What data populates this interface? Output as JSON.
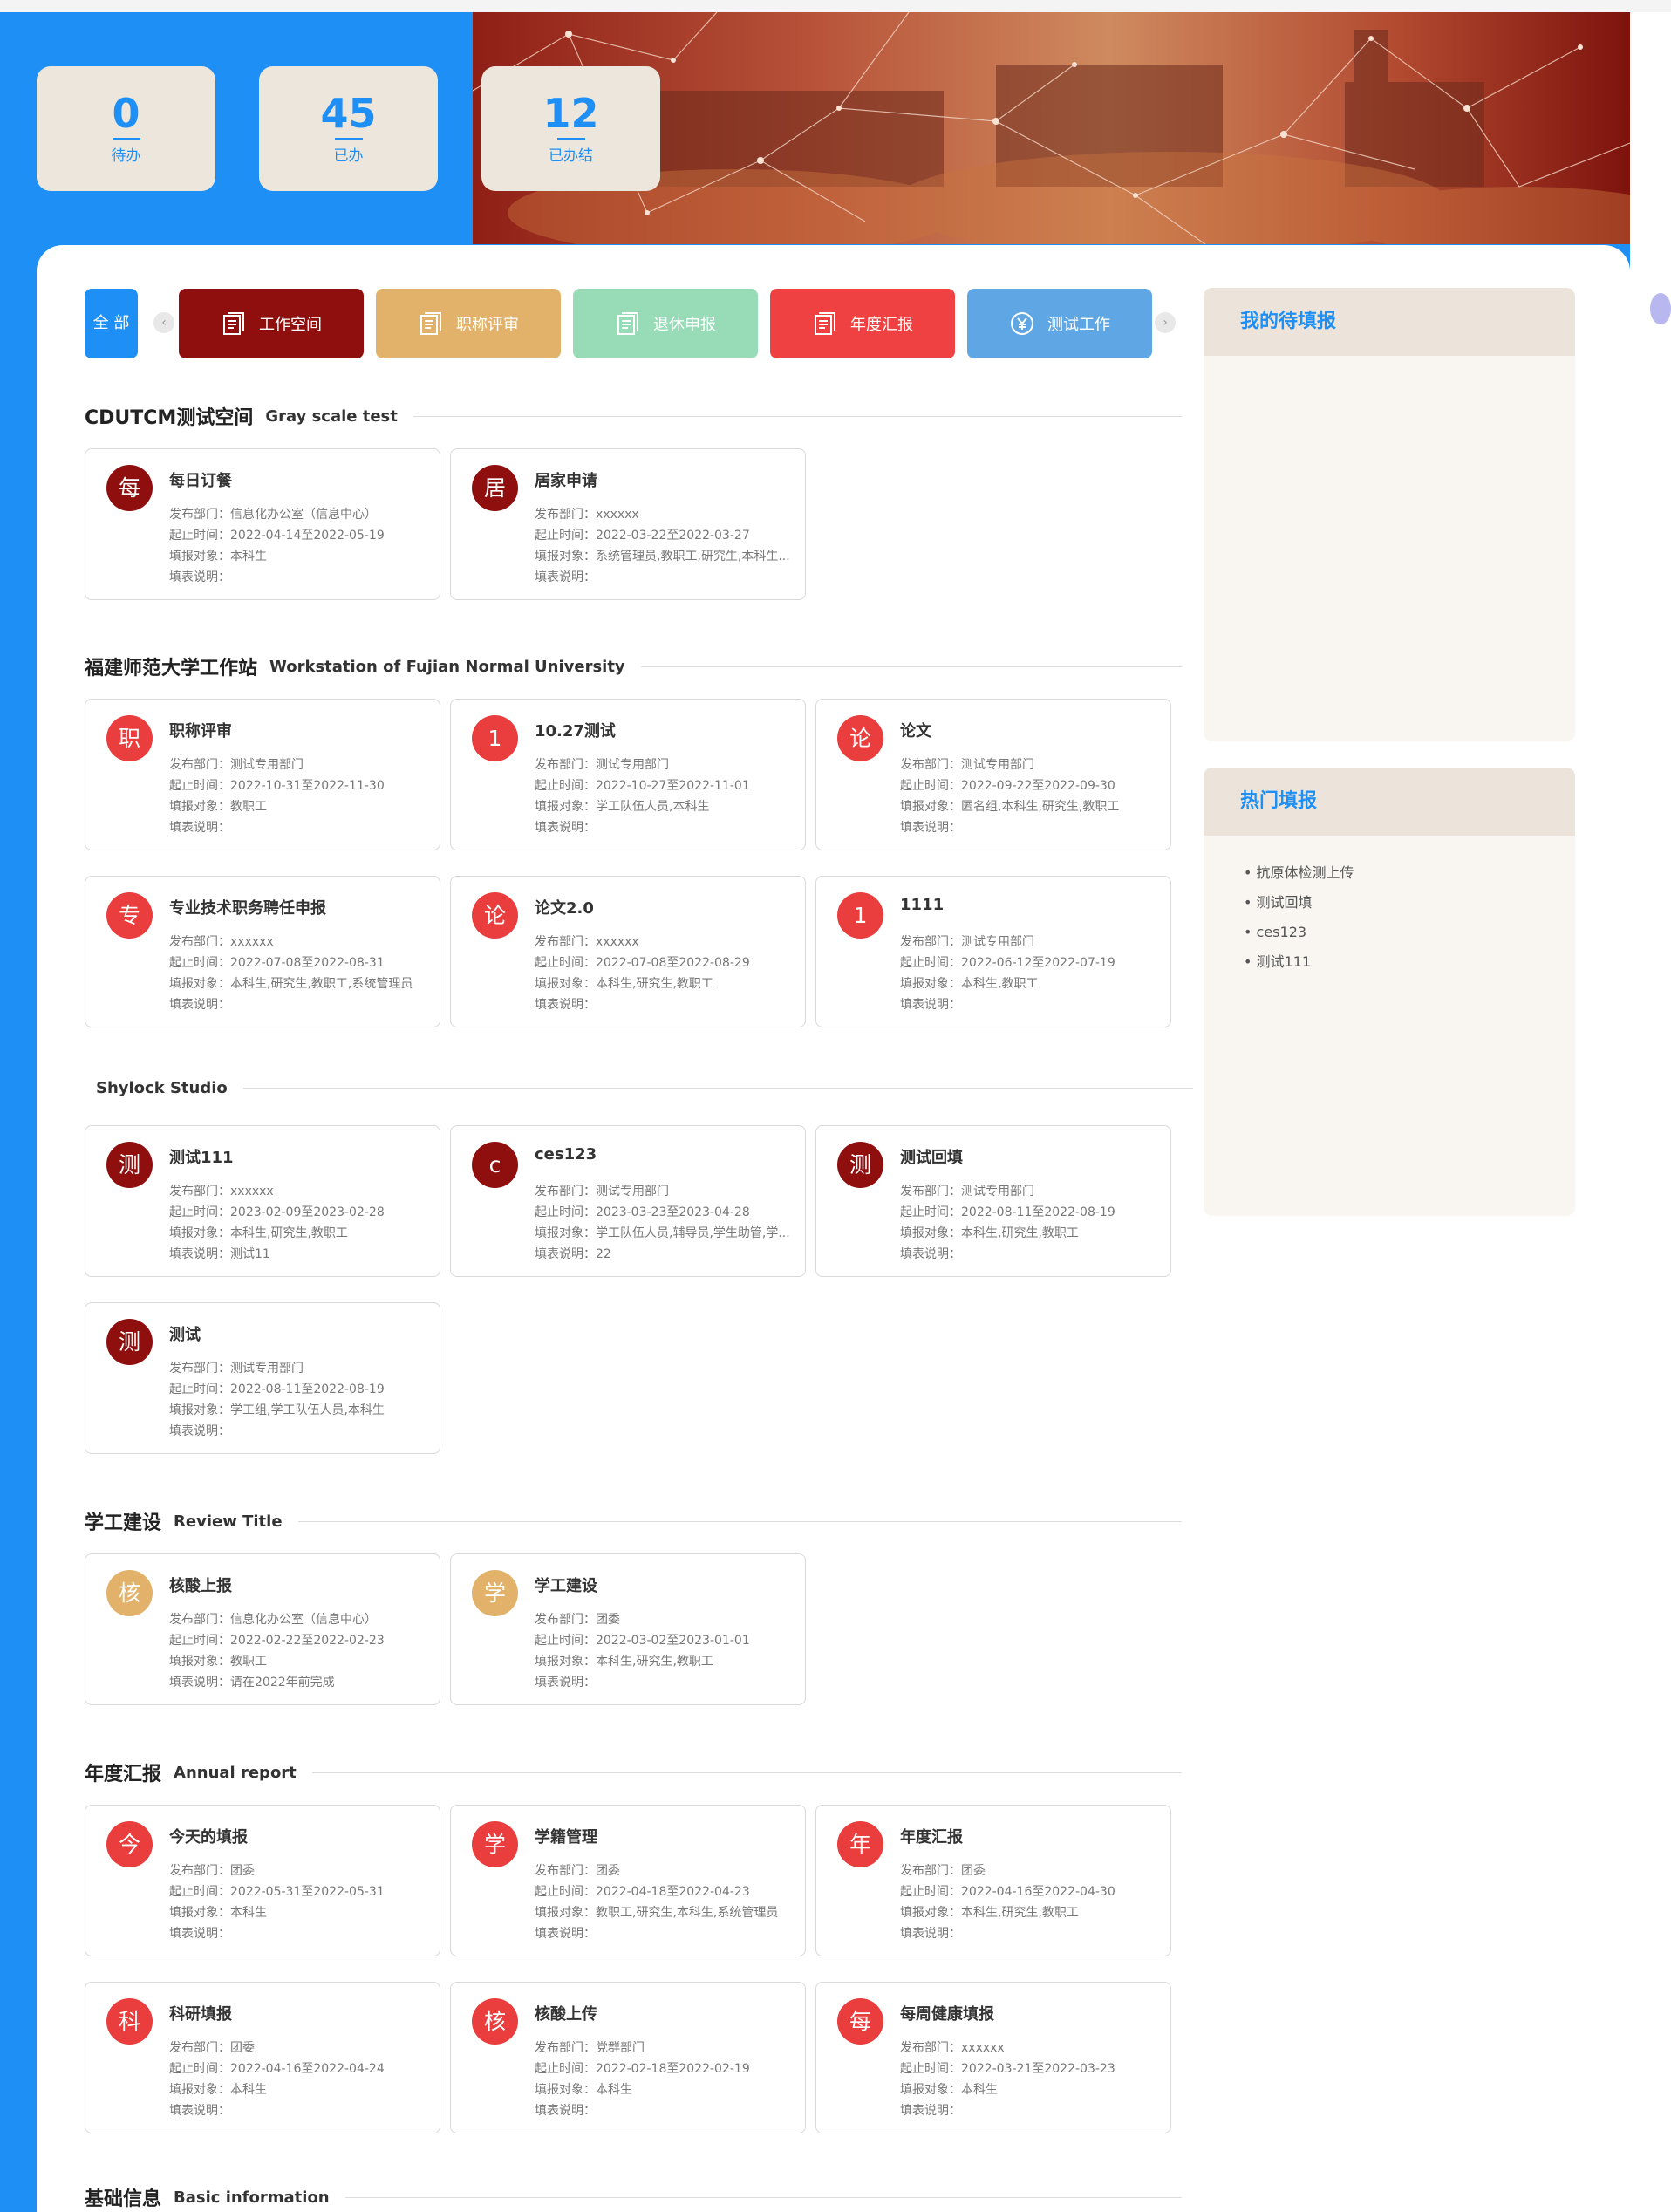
{
  "stats": [
    {
      "value": "0",
      "label": "待办"
    },
    {
      "value": "45",
      "label": "已办"
    },
    {
      "value": "12",
      "label": "已办结"
    }
  ],
  "filter": {
    "all_label": "全 部",
    "prev": "‹",
    "next": "›",
    "categories": [
      {
        "label": "工作空间",
        "color": "#8f0f0f",
        "icon": "document-icon"
      },
      {
        "label": "职称评审",
        "color": "#e2b26a",
        "icon": "document-icon"
      },
      {
        "label": "退休申报",
        "color": "#98dbb7",
        "icon": "document-icon"
      },
      {
        "label": "年度汇报",
        "color": "#ef4141",
        "icon": "document-icon"
      },
      {
        "label": "测试工作",
        "color": "#5fa7e4",
        "icon": "yen-circle-icon"
      }
    ]
  },
  "labels": {
    "dept": "发布部门：",
    "time": "起止时间：",
    "target": "填报对象：",
    "note": "填表说明："
  },
  "sections": [
    {
      "cn": "CDUTCM测试空间",
      "en": "Gray scale test",
      "cards": [
        {
          "avatar": "每",
          "color": "#8f0f0f",
          "title": "每日订餐",
          "dept": "信息化办公室（信息中心）",
          "time": "2022-04-14至2022-05-19",
          "target": "本科生",
          "note": ""
        },
        {
          "avatar": "居",
          "color": "#8f0f0f",
          "title": "居家申请",
          "dept": "xxxxxx",
          "time": "2022-03-22至2022-03-27",
          "target": "系统管理员,教职工,研究生,本科生...",
          "note": ""
        }
      ]
    },
    {
      "cn": "福建师范大学工作站",
      "en": "Workstation of Fujian Normal University",
      "cards": [
        {
          "avatar": "职",
          "color": "#ea3d3d",
          "title": "职称评审",
          "dept": "测试专用部门",
          "time": "2022-10-31至2022-11-30",
          "target": "教职工",
          "note": ""
        },
        {
          "avatar": "1",
          "color": "#ea3d3d",
          "title": "10.27测试",
          "dept": "测试专用部门",
          "time": "2022-10-27至2022-11-01",
          "target": "学工队伍人员,本科生",
          "note": ""
        },
        {
          "avatar": "论",
          "color": "#ea3d3d",
          "title": "论文",
          "dept": "测试专用部门",
          "time": "2022-09-22至2022-09-30",
          "target": "匿名组,本科生,研究生,教职工",
          "note": ""
        },
        {
          "avatar": "专",
          "color": "#ea3d3d",
          "title": "专业技术职务聘任申报",
          "dept": "xxxxxx",
          "time": "2022-07-08至2022-08-31",
          "target": "本科生,研究生,教职工,系统管理员",
          "note": ""
        },
        {
          "avatar": "论",
          "color": "#ea3d3d",
          "title": "论文2.0",
          "dept": "xxxxxx",
          "time": "2022-07-08至2022-08-29",
          "target": "本科生,研究生,教职工",
          "note": ""
        },
        {
          "avatar": "1",
          "color": "#ea3d3d",
          "title": "1111",
          "dept": "测试专用部门",
          "time": "2022-06-12至2022-07-19",
          "target": "本科生,教职工",
          "note": ""
        }
      ]
    },
    {
      "cn": "",
      "en": "Shylock Studio",
      "cards": [
        {
          "avatar": "测",
          "color": "#8f0f0f",
          "title": "测试111",
          "dept": "xxxxxx",
          "time": "2023-02-09至2023-02-28",
          "target": "本科生,研究生,教职工",
          "note": "测试11"
        },
        {
          "avatar": "c",
          "color": "#8f0f0f",
          "title": "ces123",
          "dept": "测试专用部门",
          "time": "2023-03-23至2023-04-28",
          "target": "学工队伍人员,辅导员,学生助管,学...",
          "note": "22"
        },
        {
          "avatar": "测",
          "color": "#8f0f0f",
          "title": "测试回填",
          "dept": "测试专用部门",
          "time": "2022-08-11至2022-08-19",
          "target": "本科生,研究生,教职工",
          "note": ""
        },
        {
          "avatar": "测",
          "color": "#8f0f0f",
          "title": "测试",
          "dept": "测试专用部门",
          "time": "2022-08-11至2022-08-19",
          "target": "学工组,学工队伍人员,本科生",
          "note": ""
        }
      ]
    },
    {
      "cn": "学工建设",
      "en": "Review Title",
      "cards": [
        {
          "avatar": "核",
          "color": "#e2b26a",
          "title": "核酸上报",
          "dept": "信息化办公室（信息中心）",
          "time": "2022-02-22至2022-02-23",
          "target": "教职工",
          "note": "请在2022年前完成"
        },
        {
          "avatar": "学",
          "color": "#e2b26a",
          "title": "学工建设",
          "dept": "团委",
          "time": "2022-03-02至2023-01-01",
          "target": "本科生,研究生,教职工",
          "note": ""
        }
      ]
    },
    {
      "cn": "年度汇报",
      "en": "Annual report",
      "cards": [
        {
          "avatar": "今",
          "color": "#ea3d3d",
          "title": "今天的填报",
          "dept": "团委",
          "time": "2022-05-31至2022-05-31",
          "target": "本科生",
          "note": ""
        },
        {
          "avatar": "学",
          "color": "#ea3d3d",
          "title": "学籍管理",
          "dept": "团委",
          "time": "2022-04-18至2022-04-23",
          "target": "教职工,研究生,本科生,系统管理员",
          "note": ""
        },
        {
          "avatar": "年",
          "color": "#ea3d3d",
          "title": "年度汇报",
          "dept": "团委",
          "time": "2022-04-16至2022-04-30",
          "target": "本科生,研究生,教职工",
          "note": ""
        },
        {
          "avatar": "科",
          "color": "#ea3d3d",
          "title": "科研填报",
          "dept": "团委",
          "time": "2022-04-16至2022-04-24",
          "target": "本科生",
          "note": ""
        },
        {
          "avatar": "核",
          "color": "#ea3d3d",
          "title": "核酸上传",
          "dept": "党群部门",
          "time": "2022-02-18至2022-02-19",
          "target": "本科生",
          "note": ""
        },
        {
          "avatar": "每",
          "color": "#ea3d3d",
          "title": "每周健康填报",
          "dept": "xxxxxx",
          "time": "2022-03-21至2022-03-23",
          "target": "本科生",
          "note": ""
        }
      ]
    },
    {
      "cn": "基础信息",
      "en": "Basic information",
      "cards": []
    }
  ],
  "sidebar": {
    "pending": {
      "title": "我的待填报",
      "items": []
    },
    "hot": {
      "title": "热门填报",
      "items": [
        "抗原体检测上传",
        "测试回填",
        "ces123",
        "测试111"
      ]
    }
  }
}
